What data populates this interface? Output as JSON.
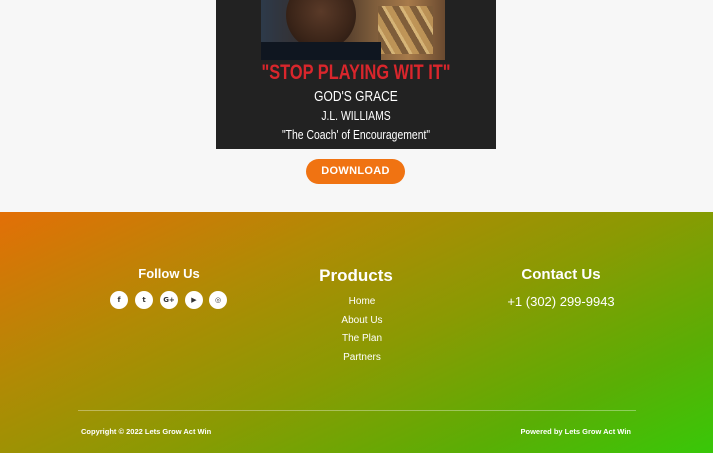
{
  "cover": {
    "title": "\"STOP PLAYING WIT IT\"",
    "line1": "GOD'S GRACE",
    "line2": "J.L. WILLIAMS",
    "line3": "\"The Coach' of Encouragement\""
  },
  "download_label": "DOWNLOAD",
  "footer": {
    "follow_title": "Follow Us",
    "socials": [
      {
        "icon": "facebook-icon",
        "glyph": "f"
      },
      {
        "icon": "twitter-icon",
        "glyph": "t"
      },
      {
        "icon": "google-plus-icon",
        "glyph": "G+"
      },
      {
        "icon": "youtube-icon",
        "glyph": "▶"
      },
      {
        "icon": "instagram-icon",
        "glyph": "◎"
      }
    ],
    "products_title": "Products",
    "links": [
      "Home",
      "About Us",
      "The Plan",
      "Partners"
    ],
    "contact_title": "Contact Us",
    "phone": "+1 (302) 299-9943",
    "copyright": "Copyright © 2022 Lets Grow Act Win",
    "powered": "Powered by Lets Grow Act Win"
  },
  "colors": {
    "accent_orange": "#f07312",
    "cover_red": "#d9262c",
    "footer_start": "#e36f07",
    "footer_end": "#38c808"
  }
}
